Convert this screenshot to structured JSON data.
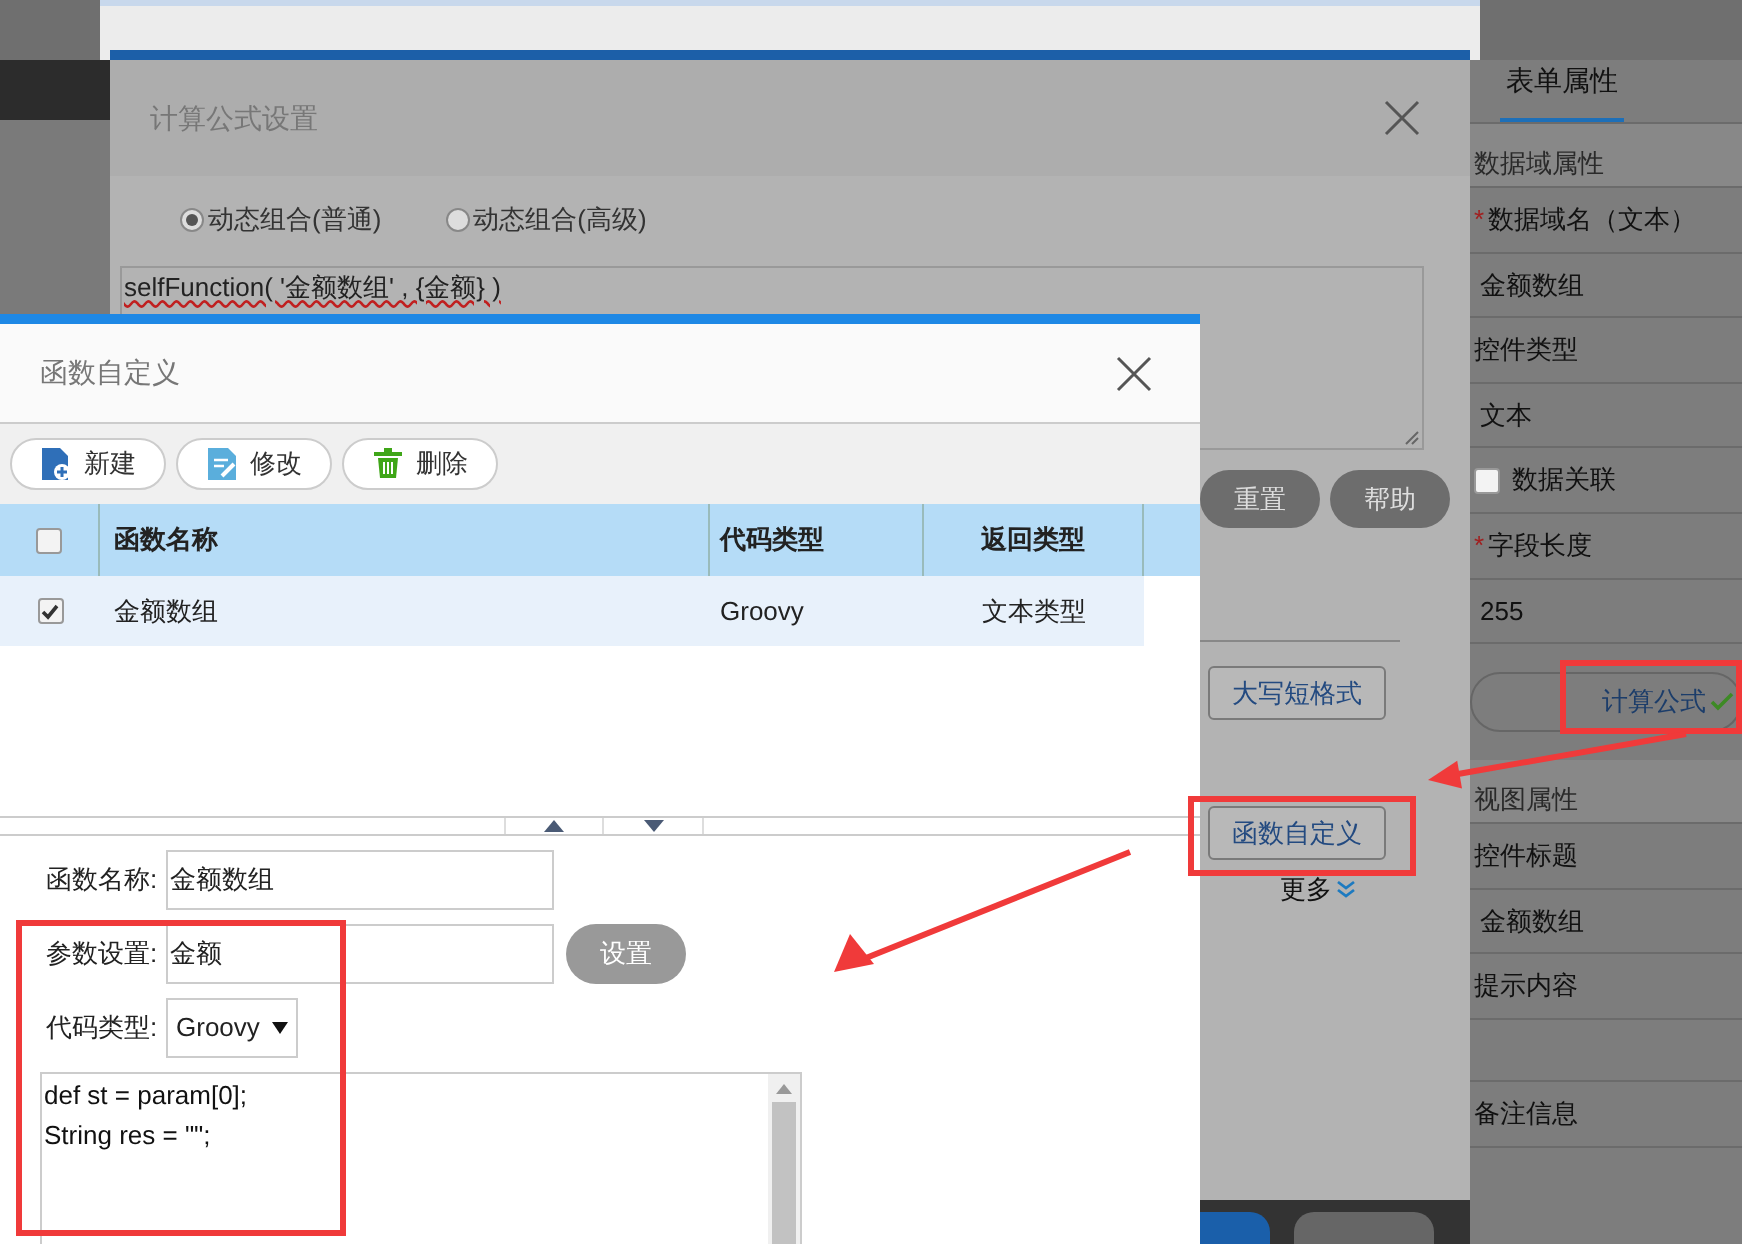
{
  "formula_dialog": {
    "title": "计算公式设置",
    "modes": [
      {
        "label": "动态组合(普通)",
        "selected": true
      },
      {
        "label": "动态组合(高级)",
        "selected": false
      }
    ],
    "formula": "selfFunction( '金额数组' , {金额} )",
    "buttons": [
      "重置",
      "帮助"
    ],
    "format_buttons": [
      "大写短格式",
      "函数自定义"
    ],
    "more": "更多"
  },
  "function_dialog": {
    "title": "函数自定义",
    "toolbar": [
      {
        "label": "新建",
        "kind": "new"
      },
      {
        "label": "修改",
        "kind": "edit"
      },
      {
        "label": "删除",
        "kind": "delete"
      }
    ],
    "table": {
      "header_checked": false,
      "columns": [
        "函数名称",
        "代码类型",
        "返回类型"
      ],
      "rows": [
        {
          "checked": true,
          "cells": [
            "金额数组",
            "Groovy",
            "文本类型"
          ]
        }
      ]
    },
    "form": {
      "name_label": "函数名称:",
      "name_value": "金额数组",
      "param_label": "参数设置:",
      "param_value": "金额",
      "param_button": "设置",
      "code_type_label": "代码类型:",
      "code_type_value": "Groovy",
      "code_lines": [
        "def st = param[0];",
        "String res = \"\";"
      ]
    }
  },
  "properties_panel": {
    "tab": {
      "label": "表单属性",
      "selected": true
    },
    "items": [
      {
        "kind": "section",
        "text": "数据域属性"
      },
      {
        "kind": "label",
        "text": "数据域名（文本）",
        "required_mark": "*"
      },
      {
        "kind": "value",
        "text": "金额数组"
      },
      {
        "kind": "label",
        "text": "控件类型"
      },
      {
        "kind": "value",
        "text": "文本"
      },
      {
        "kind": "checkbox",
        "text": "数据关联",
        "checked": false
      },
      {
        "kind": "label",
        "text": "字段长度",
        "required_mark": "*"
      },
      {
        "kind": "value",
        "text": "255"
      },
      {
        "kind": "button",
        "text": "计算公式"
      },
      {
        "kind": "section",
        "text": "视图属性"
      },
      {
        "kind": "label",
        "text": "控件标题"
      },
      {
        "kind": "value",
        "text": "金额数组"
      },
      {
        "kind": "label",
        "text": "提示内容"
      },
      {
        "kind": "blank"
      },
      {
        "kind": "label",
        "text": "备注信息"
      }
    ]
  }
}
